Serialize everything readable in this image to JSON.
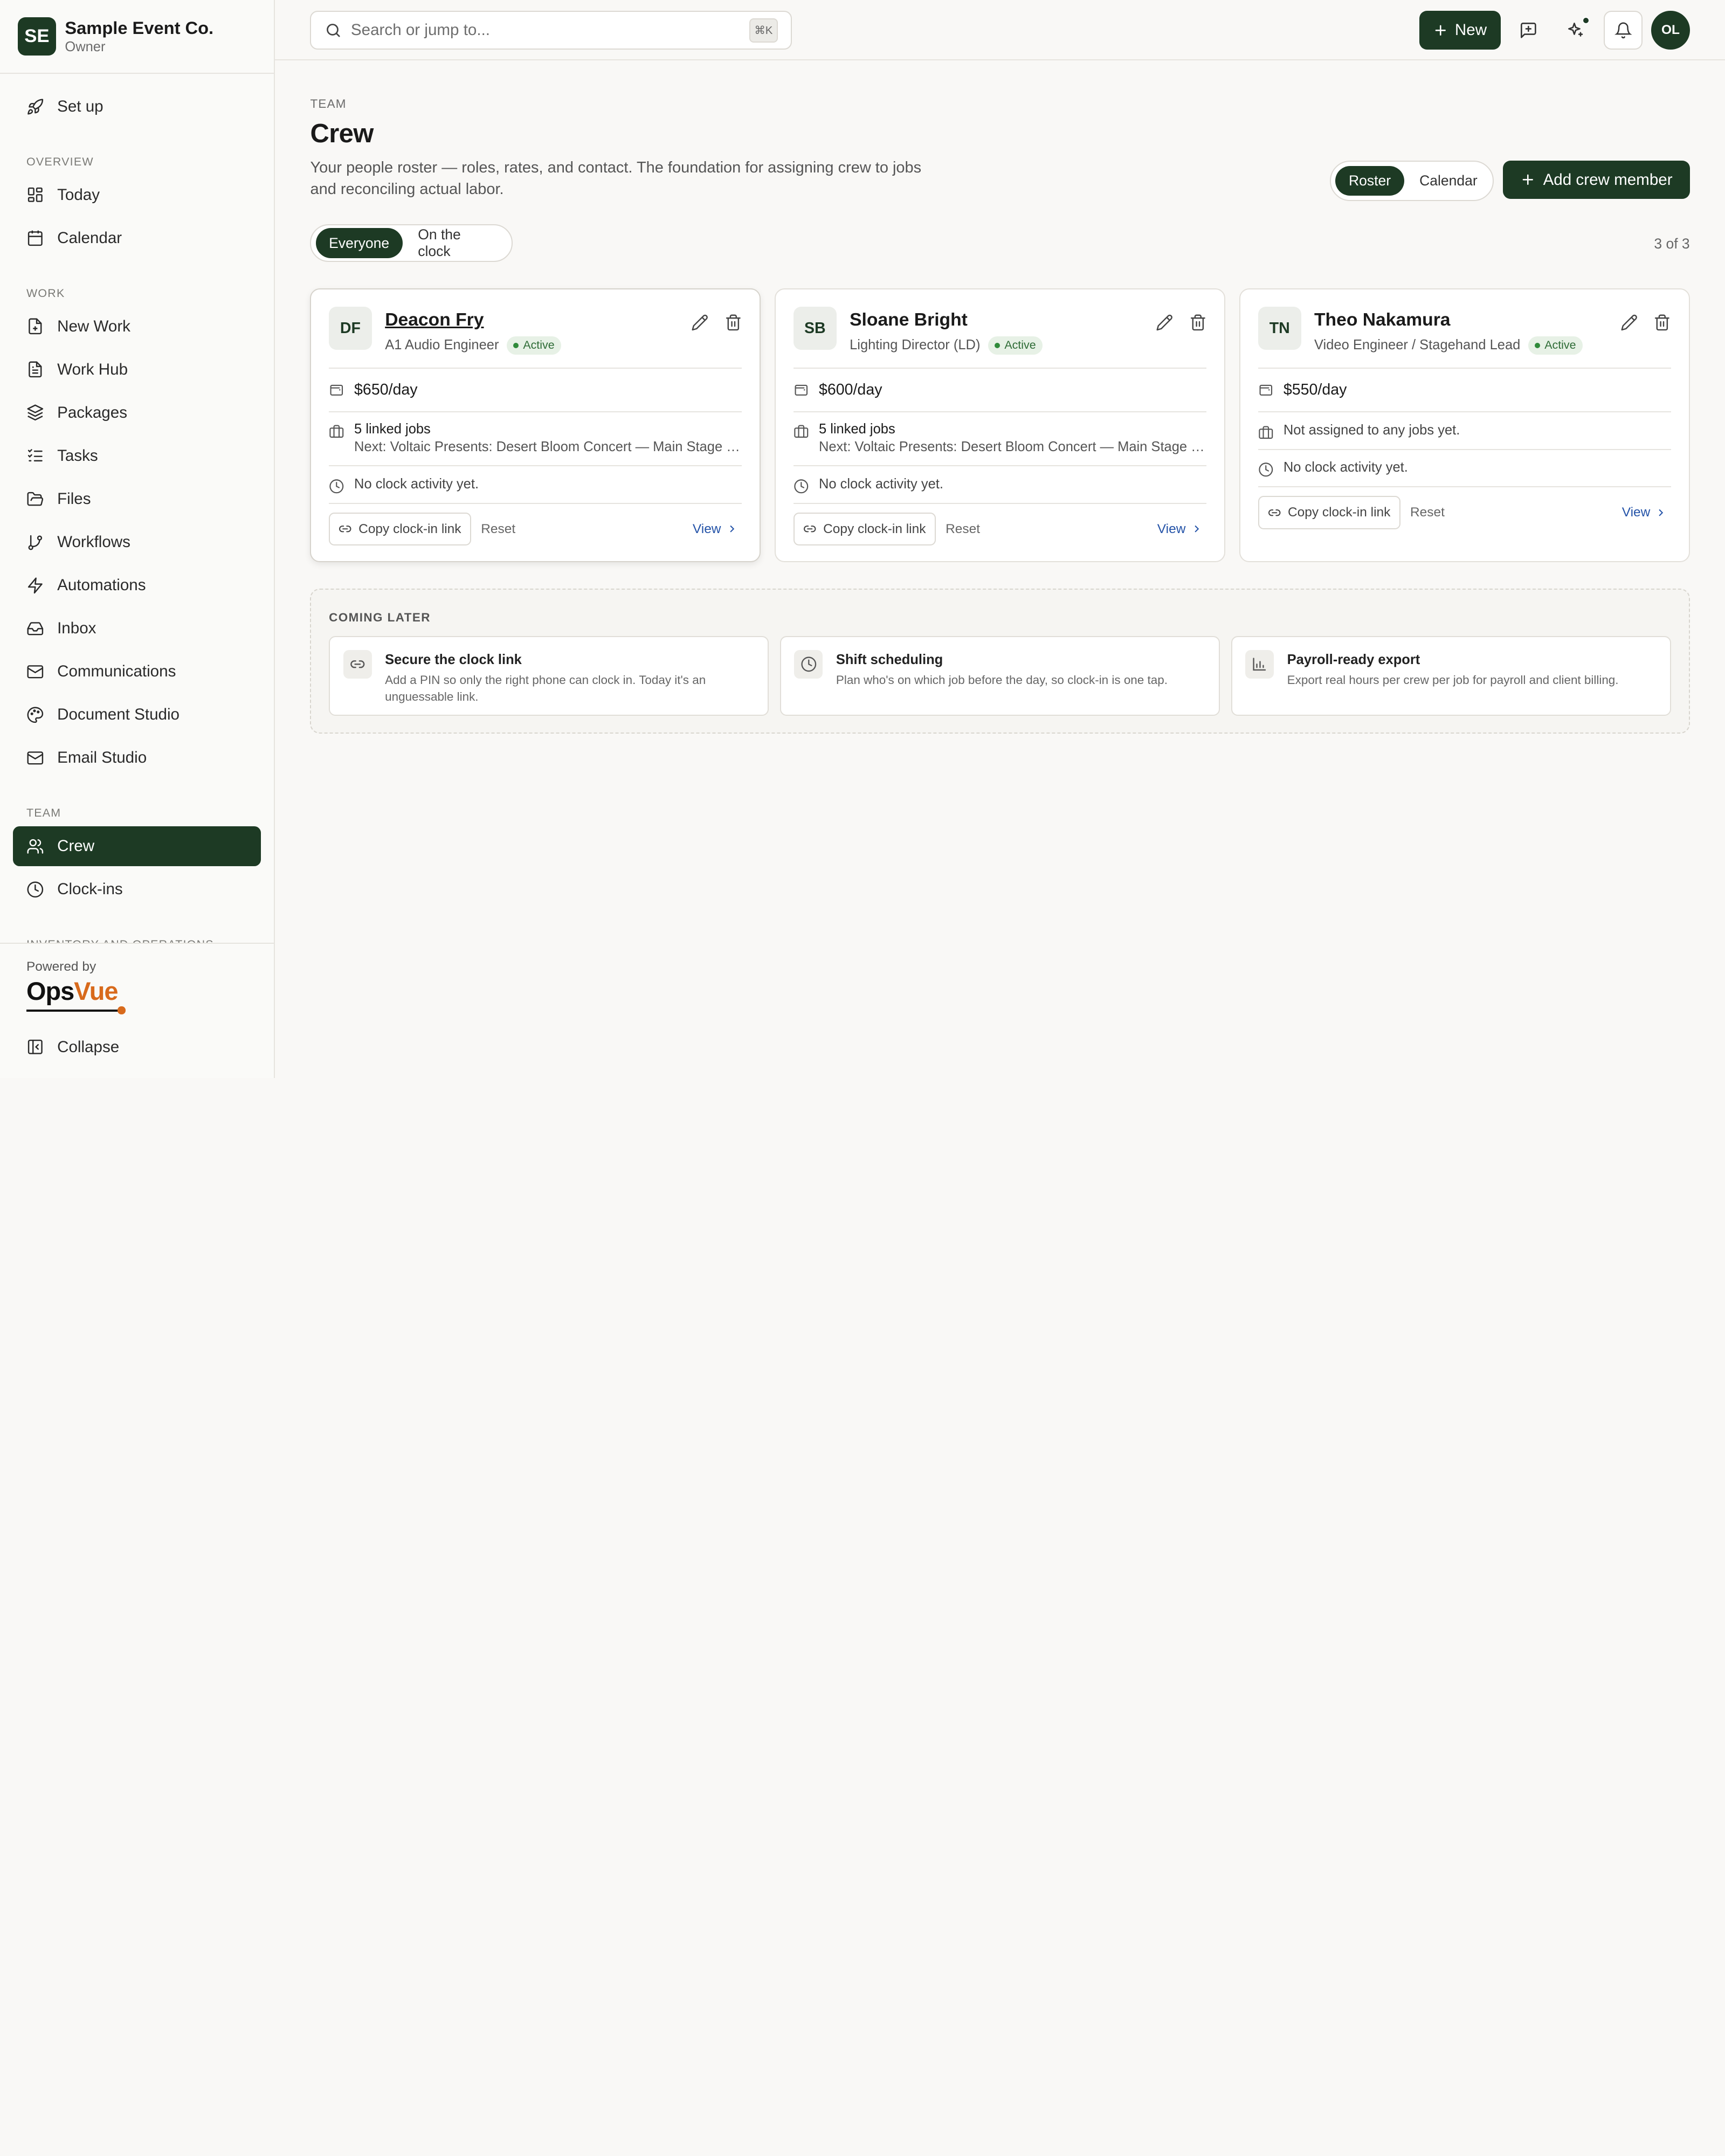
{
  "org": {
    "initials": "SE",
    "name": "Sample Event Co.",
    "role": "Owner"
  },
  "sidebar": {
    "setup": "Set up",
    "sections": {
      "overview": "OVERVIEW",
      "work": "WORK",
      "team": "TEAM",
      "inventory": "INVENTORY AND OPERATIONS"
    },
    "items": {
      "today": "Today",
      "calendar": "Calendar",
      "new_work": "New Work",
      "work_hub": "Work Hub",
      "packages": "Packages",
      "tasks": "Tasks",
      "files": "Files",
      "workflows": "Workflows",
      "automations": "Automations",
      "inbox": "Inbox",
      "communications": "Communications",
      "document_studio": "Document Studio",
      "email_studio": "Email Studio",
      "crew": "Crew",
      "clock_ins": "Clock-ins"
    },
    "active": "crew",
    "powered_by": "Powered by",
    "logo": {
      "part1": "Ops",
      "part2": "Vue"
    },
    "collapse": "Collapse"
  },
  "topbar": {
    "search_placeholder": "Search or jump to...",
    "shortcut": "⌘K",
    "new_label": "New",
    "user_initials": "OL"
  },
  "page": {
    "eyebrow": "TEAM",
    "title": "Crew",
    "description": "Your people roster — roles, rates, and contact. The foundation for assigning crew to jobs and reconciling actual labor.",
    "view_toggle": {
      "roster": "Roster",
      "calendar": "Calendar",
      "selected": "roster"
    },
    "add_button": "Add crew member",
    "filter": {
      "everyone": "Everyone",
      "on_clock": "On the clock",
      "selected": "everyone"
    },
    "count": "3 of 3"
  },
  "crew": [
    {
      "initials": "DF",
      "name": "Deacon Fry",
      "role": "A1 Audio Engineer",
      "status": "Active",
      "rate": "$650/day",
      "jobs": "5 linked jobs",
      "next": "Next: Voltaic Presents: Desert Bloom Concert — Main Stage P...",
      "clock": "No clock activity yet.",
      "copy": "Copy clock-in link",
      "reset": "Reset",
      "view": "View"
    },
    {
      "initials": "SB",
      "name": "Sloane Bright",
      "role": "Lighting Director (LD)",
      "status": "Active",
      "rate": "$600/day",
      "jobs": "5 linked jobs",
      "next": "Next: Voltaic Presents: Desert Bloom Concert — Main Stage P...",
      "clock": "No clock activity yet.",
      "copy": "Copy clock-in link",
      "reset": "Reset",
      "view": "View"
    },
    {
      "initials": "TN",
      "name": "Theo Nakamura",
      "role": "Video Engineer / Stagehand Lead",
      "status": "Active",
      "rate": "$550/day",
      "jobs": "Not assigned to any jobs yet.",
      "clock": "No clock activity yet.",
      "copy": "Copy clock-in link",
      "reset": "Reset",
      "view": "View"
    }
  ],
  "coming_later": {
    "title": "COMING LATER",
    "items": [
      {
        "icon": "link-icon",
        "title": "Secure the clock link",
        "desc": "Add a PIN so only the right phone can clock in. Today it's an unguessable link."
      },
      {
        "icon": "clock-icon",
        "title": "Shift scheduling",
        "desc": "Plan who's on which job before the day, so clock-in is one tap."
      },
      {
        "icon": "bar-chart-icon",
        "title": "Payroll-ready export",
        "desc": "Export real hours per crew per job for payroll and client billing."
      }
    ]
  },
  "colors": {
    "brand": "#1d3a24",
    "accent": "#d86a1c",
    "link": "#2453a8",
    "active_badge": "#2d6b35"
  }
}
